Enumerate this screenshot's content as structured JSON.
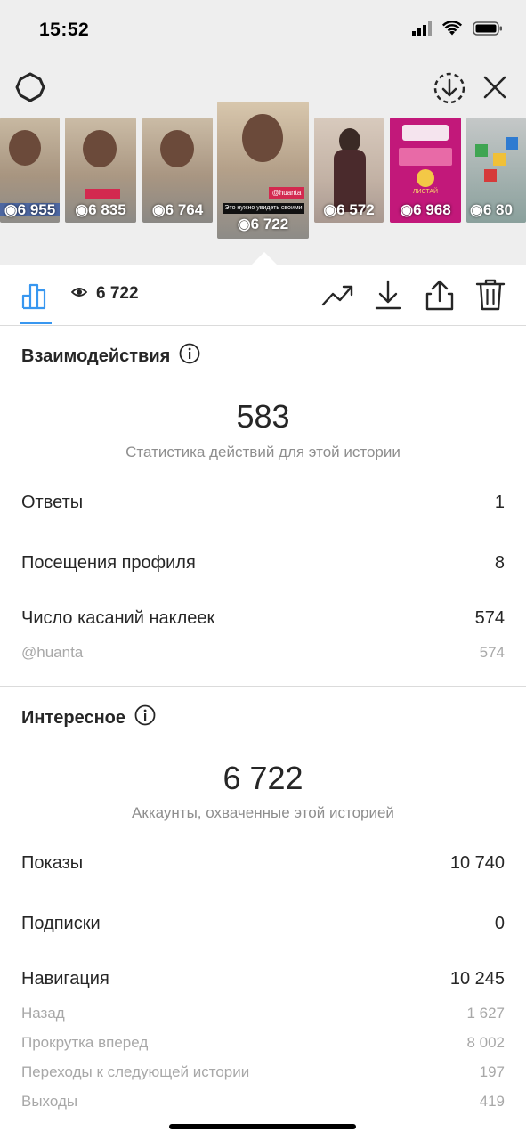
{
  "status_bar": {
    "time": "15:52"
  },
  "thumbnails": [
    {
      "views": "6 955",
      "selected": false
    },
    {
      "views": "6 835",
      "selected": false
    },
    {
      "views": "6 764",
      "selected": false
    },
    {
      "views": "6 722",
      "selected": true,
      "caption": "Это нужно увидеть своими",
      "tag": "@huanta"
    },
    {
      "views": "6 572",
      "selected": false
    },
    {
      "views": "6 968",
      "selected": false,
      "poster_text": "ЛИСТАЙ"
    },
    {
      "views": "6 80",
      "selected": false
    }
  ],
  "toolbar": {
    "views": "6 722"
  },
  "interactions": {
    "title": "Взаимодействия",
    "total": "583",
    "caption": "Статистика действий для этой истории",
    "rows": [
      {
        "label": "Ответы",
        "value": "1"
      },
      {
        "label": "Посещения профиля",
        "value": "8"
      },
      {
        "label": "Число касаний наклеек",
        "value": "574"
      }
    ],
    "sub_rows": [
      {
        "label": "@huanta",
        "value": "574"
      }
    ]
  },
  "discovery": {
    "title": "Интересное",
    "total": "6 722",
    "caption": "Аккаунты, охваченные этой историей",
    "rows": [
      {
        "label": "Показы",
        "value": "10 740"
      },
      {
        "label": "Подписки",
        "value": "0"
      },
      {
        "label": "Навигация",
        "value": "10 245"
      }
    ],
    "sub_rows": [
      {
        "label": "Назад",
        "value": "1 627"
      },
      {
        "label": "Прокрутка вперед",
        "value": "8 002"
      },
      {
        "label": "Переходы к следующей истории",
        "value": "197"
      },
      {
        "label": "Выходы",
        "value": "419"
      }
    ]
  },
  "colors": {
    "accent": "#3897f0",
    "muted": "#8e8e8e",
    "divider": "#dbdbdb"
  }
}
